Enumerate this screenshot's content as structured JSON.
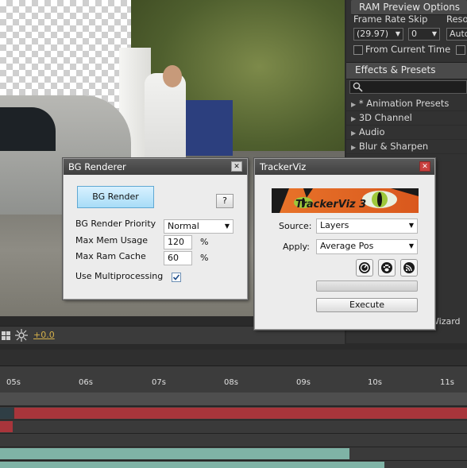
{
  "right_panel": {
    "ram_preview_title": "RAM Preview Options",
    "frame_rate_label": "Frame Rate",
    "skip_label": "Skip",
    "resolution_label": "Reso",
    "frame_rate_value": "(29.97)",
    "skip_value": "0",
    "resolution_value": "Auto",
    "from_current_time_label": "From Current Time",
    "effects_title": "Effects & Presets",
    "effects_items": [
      "* Animation Presets",
      "3D Channel",
      "Audio",
      "Blur & Sharpen"
    ],
    "wizard_text": "Wizard"
  },
  "viewer_toolbar": {
    "exposure_value": "+0.0"
  },
  "timeline": {
    "ticks": [
      "05s",
      "06s",
      "07s",
      "08s",
      "09s",
      "10s",
      "11s"
    ]
  },
  "bg_renderer": {
    "title": "BG Renderer",
    "render_button": "BG Render",
    "help_button": "?",
    "priority_label": "BG Render Priority",
    "priority_value": "Normal",
    "max_mem_label": "Max Mem Usage",
    "max_mem_value": "120",
    "max_ram_label": "Max Ram Cache",
    "max_ram_value": "60",
    "percent_symbol": "%",
    "multiprocessing_label": "Use Multiprocessing",
    "multiprocessing_checked": true
  },
  "trackerviz": {
    "title": "TrackerViz",
    "logo_text": "TrackerViz 3",
    "source_label": "Source:",
    "source_value": "Layers",
    "apply_label": "Apply:",
    "apply_value": "Average Pos",
    "execute_button": "Execute"
  },
  "colors": {
    "layer_bar_red": "#a8353b",
    "layer_bar_teal": "#7fb3a6",
    "time_value": "#d6b14a"
  }
}
